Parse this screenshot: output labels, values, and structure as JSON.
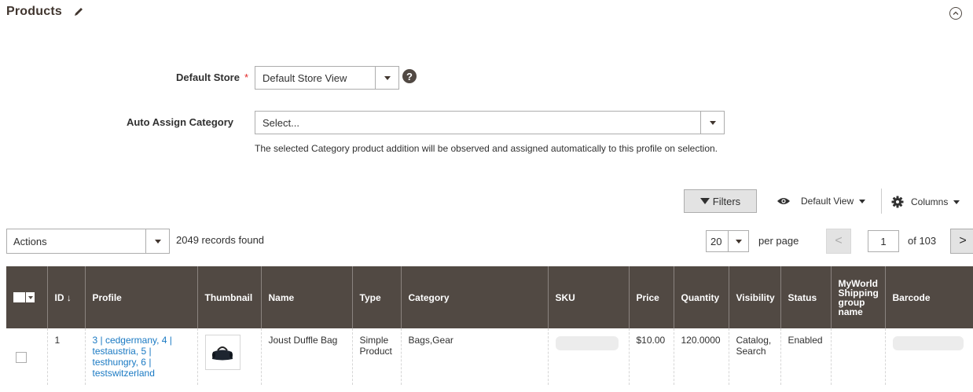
{
  "section": {
    "title": "Products"
  },
  "form": {
    "default_store": {
      "label": "Default Store",
      "required_mark": "*",
      "value": "Default Store View"
    },
    "auto_assign": {
      "label": "Auto Assign Category",
      "placeholder": "Select...",
      "note": "The selected Category product addition will be observed and assigned automatically to this profile on selection."
    },
    "help_glyph": "?"
  },
  "toolbar": {
    "filters_label": "Filters",
    "view_label": "Default View",
    "columns_label": "Columns",
    "actions_label": "Actions",
    "records_found": "2049 records found",
    "per_page_value": "20",
    "per_page_label": "per page",
    "current_page": "1",
    "of_pages": "of 103",
    "prev_glyph": "<",
    "next_glyph": ">"
  },
  "table": {
    "headers": {
      "id": "ID ↓",
      "profile": "Profile",
      "thumbnail": "Thumbnail",
      "name": "Name",
      "type": "Type",
      "category": "Category",
      "sku": "SKU",
      "price": "Price",
      "quantity": "Quantity",
      "visibility": "Visibility",
      "status": "Status",
      "shipping": "MyWorld Shipping group name",
      "barcode": "Barcode"
    },
    "rows": [
      {
        "id": "1",
        "profile": "3 | cedgermany, 4 | testaustria, 5 | testhungry, 6 | testswitzerland",
        "name": "Joust Duffle Bag",
        "type": "Simple Product",
        "category": "Bags,Gear",
        "price": "$10.00",
        "quantity": "120.0000",
        "visibility": "Catalog, Search",
        "status": "Enabled",
        "shipping": ""
      }
    ]
  },
  "colors": {
    "header_bg": "#514943",
    "link": "#1979c3",
    "required": "#e22626"
  },
  "icons": [
    "pencil-icon",
    "collapse-icon",
    "help-icon",
    "filter-icon",
    "eye-icon",
    "gear-icon",
    "chevron-down-icon"
  ]
}
